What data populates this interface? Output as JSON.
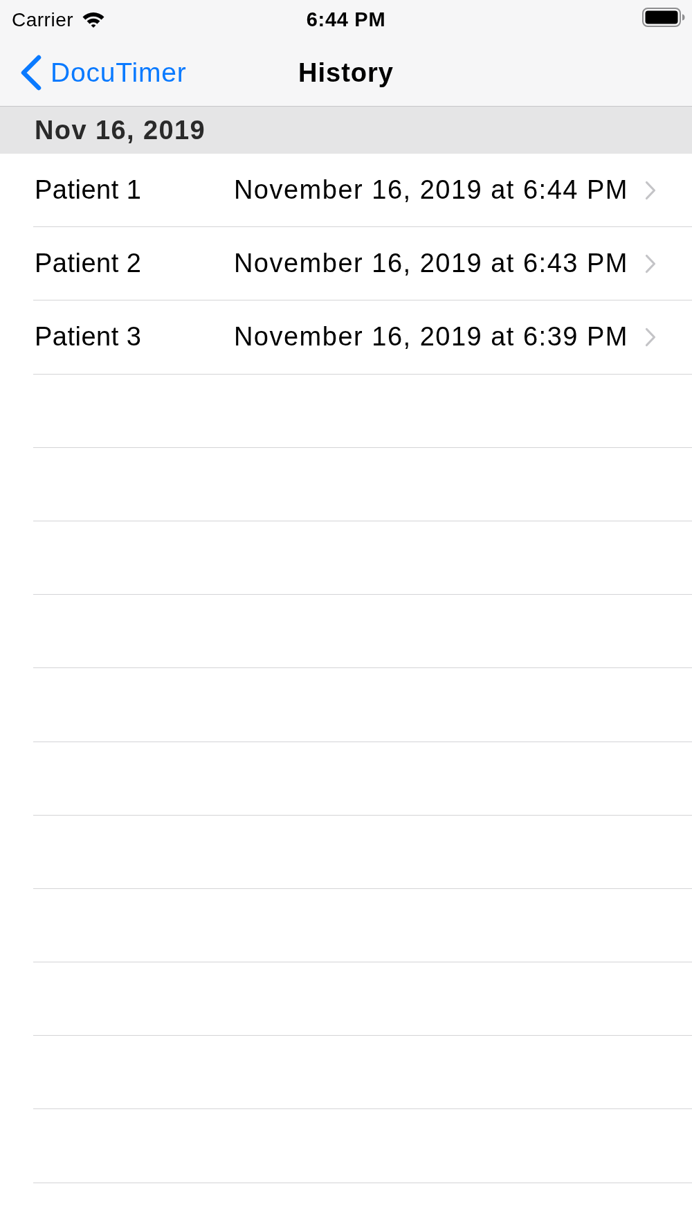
{
  "status_bar": {
    "carrier": "Carrier",
    "time": "6:44 PM"
  },
  "nav_bar": {
    "back_label": "DocuTimer",
    "title": "History"
  },
  "sections": [
    {
      "header": "Nov 16, 2019",
      "rows": [
        {
          "name": "Patient 1",
          "detail": "November 16, 2019 at 6:44 PM"
        },
        {
          "name": "Patient 2",
          "detail": "November 16, 2019 at 6:43 PM"
        },
        {
          "name": "Patient 3",
          "detail": "November 16, 2019 at 6:39 PM"
        }
      ]
    }
  ]
}
